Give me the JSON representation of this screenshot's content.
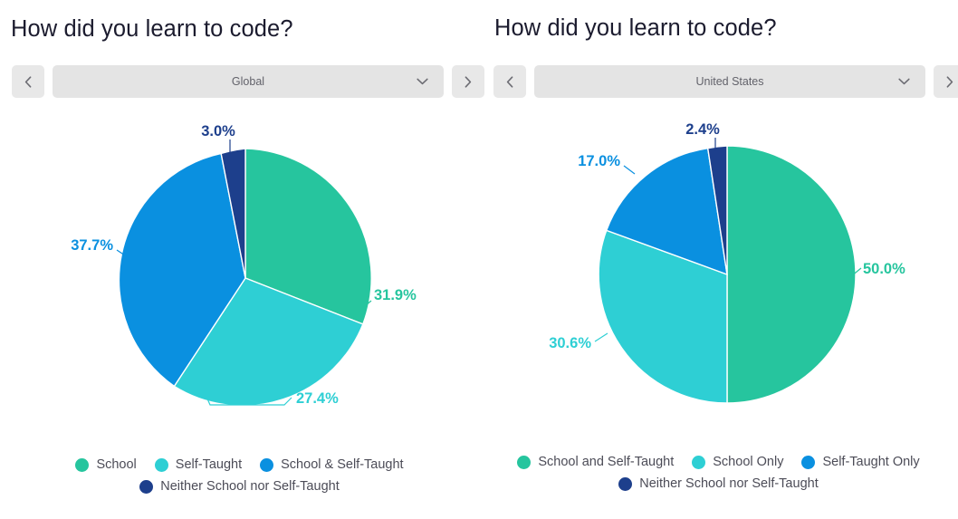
{
  "colors": {
    "green": "#26c59e",
    "cyan": "#2ecfd4",
    "blue": "#0a90e0",
    "navy": "#1d3f8c",
    "title_text": "#1b1b2e",
    "legend_text": "#4c4c57",
    "control_bg": "#e4e4e4",
    "control_icon": "#6b6b72",
    "page_bg": "#ffffff"
  },
  "panels": [
    {
      "title": "How did you learn to code?",
      "prev_button": "‹",
      "next_button": "›",
      "selector": {
        "value": "Global",
        "caret_icon": "chevron-down-icon"
      },
      "labels": {
        "green": "31.9%",
        "cyan": "27.4%",
        "blue": "37.7%",
        "navy": "3.0%"
      },
      "legend": [
        {
          "label": "School",
          "color": "#26c59e"
        },
        {
          "label": "Self-Taught",
          "color": "#2ecfd4"
        },
        {
          "label": "School & Self-Taught",
          "color": "#0a90e0"
        },
        {
          "label": "Neither School nor Self-Taught",
          "color": "#1d3f8c"
        }
      ]
    },
    {
      "title": "How did you learn to code?",
      "prev_button": "‹",
      "next_button": "›",
      "selector": {
        "value": "United States",
        "caret_icon": "chevron-down-icon"
      },
      "labels": {
        "green": "50.0%",
        "cyan": "30.6%",
        "blue": "17.0%",
        "navy": "2.4%"
      },
      "legend": [
        {
          "label": "School and Self-Taught",
          "color": "#26c59e"
        },
        {
          "label": "School Only",
          "color": "#2ecfd4"
        },
        {
          "label": "Self-Taught Only",
          "color": "#0a90e0"
        },
        {
          "label": "Neither School nor Self-Taught",
          "color": "#1d3f8c"
        }
      ]
    }
  ],
  "chart_data": [
    {
      "type": "pie",
      "title": "How did you learn to code?",
      "subtitle": "Global",
      "categories": [
        "School",
        "Self-Taught",
        "School & Self-Taught",
        "Neither School nor Self-Taught"
      ],
      "values": [
        31.9,
        27.4,
        37.7,
        3.0
      ],
      "value_labels": [
        "31.9%",
        "27.4%",
        "37.7%",
        "3.0%"
      ],
      "colors": [
        "#26c59e",
        "#2ecfd4",
        "#0a90e0",
        "#1d3f8c"
      ],
      "units": "percent",
      "start_angle_deg": 0,
      "direction": "clockwise",
      "legend_position": "bottom",
      "grid": false
    },
    {
      "type": "pie",
      "title": "How did you learn to code?",
      "subtitle": "United States",
      "categories": [
        "School and Self-Taught",
        "School Only",
        "Self-Taught Only",
        "Neither School nor Self-Taught"
      ],
      "values": [
        50.0,
        30.6,
        17.0,
        2.4
      ],
      "value_labels": [
        "50.0%",
        "30.6%",
        "17.0%",
        "2.4%"
      ],
      "colors": [
        "#26c59e",
        "#2ecfd4",
        "#0a90e0",
        "#1d3f8c"
      ],
      "units": "percent",
      "start_angle_deg": 0,
      "direction": "clockwise",
      "legend_position": "bottom",
      "grid": false
    }
  ]
}
